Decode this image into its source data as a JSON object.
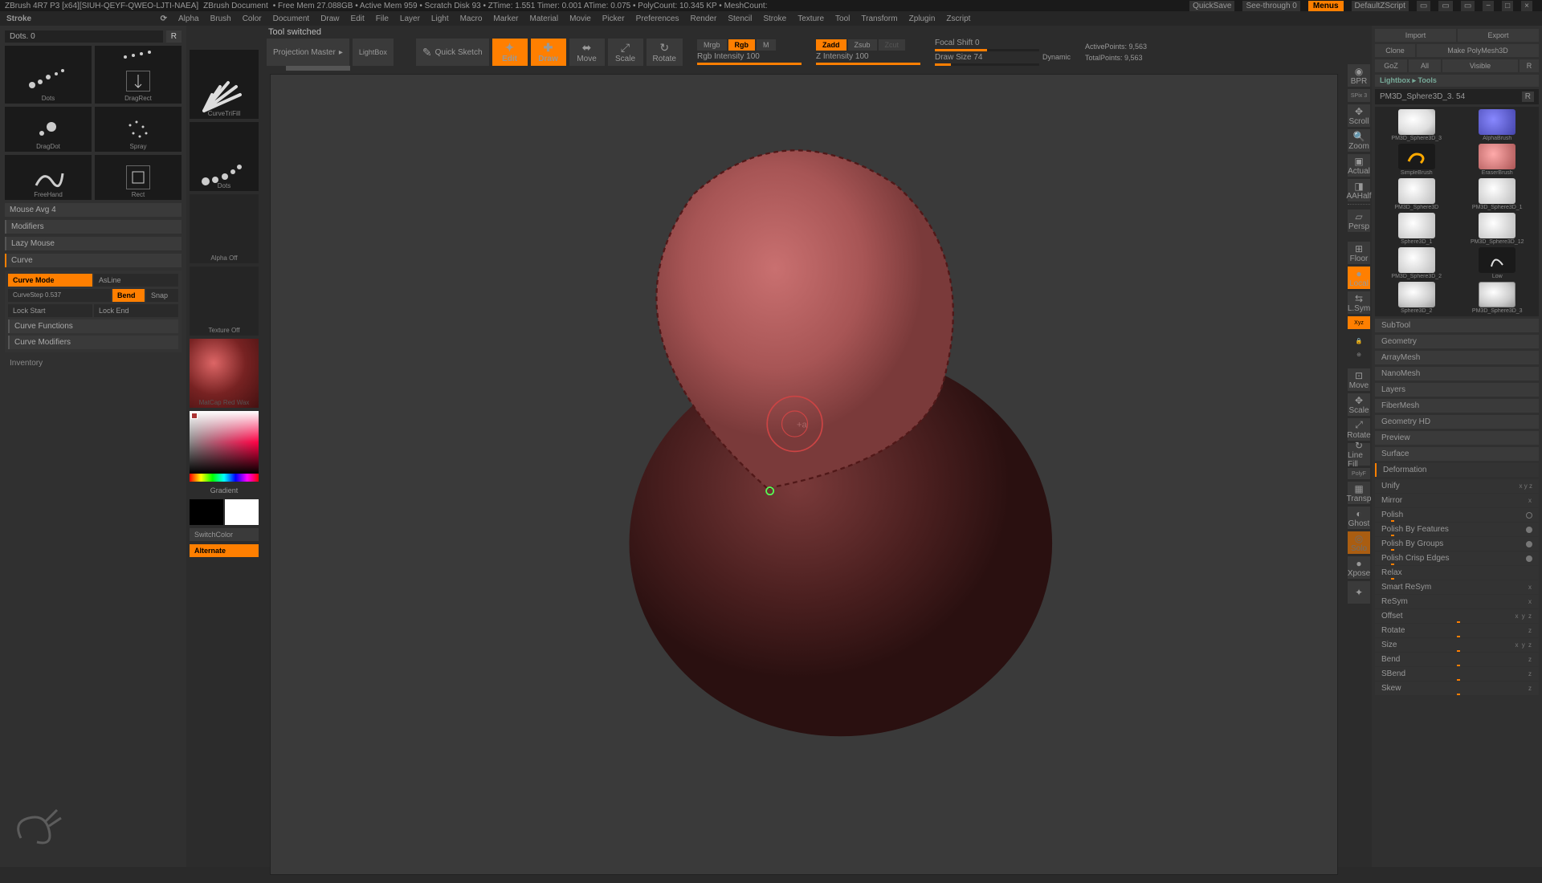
{
  "titlebar": {
    "left": "ZBrush 4R7 P3 [x64][SIUH-QEYF-QWEO-LJTI-NAEA]",
    "doc": "ZBrush Document",
    "mem": "• Free Mem 27.088GB  • Active Mem 959  • Scratch Disk 93  • ZTime: 1.551  Timer: 0.001  ATime: 0.075  • PolyCount: 10.345 KP  • MeshCount: ",
    "quicksave": "QuickSave",
    "seethrough": "See-through 0",
    "menus": "Menus",
    "script": "DefaultZScript"
  },
  "menubar": {
    "title": "Stroke",
    "items": [
      "Alpha",
      "Brush",
      "Color",
      "Document",
      "Draw",
      "Edit",
      "File",
      "Layer",
      "Light",
      "Macro",
      "Marker",
      "Material",
      "Movie",
      "Picker",
      "Preferences",
      "Render",
      "Stencil",
      "Stroke",
      "Texture",
      "Tool",
      "Transform",
      "Zplugin",
      "Zscript"
    ]
  },
  "status_msg": "Tool switched",
  "left": {
    "dots_label": "Dots. 0",
    "dots_r": "R",
    "cells": {
      "dots": "Dots",
      "dragrect": "DragRect",
      "dragdot": "DragDot",
      "spray": "Spray",
      "freehand": "FreeHand",
      "rect": "Rect"
    },
    "mouse_avg": "Mouse Avg 4",
    "modifiers": "Modifiers",
    "lazy": "Lazy Mouse",
    "curve": "Curve",
    "curve_mode": "Curve Mode",
    "asline": "AsLine",
    "curvestep": "CurveStep 0.537",
    "bend": "Bend",
    "snap": "Snap",
    "lock_start": "Lock Start",
    "lock_end": "Lock End",
    "curve_functions": "Curve Functions",
    "curve_modifiers": "Curve Modifiers",
    "inventory": "Inventory"
  },
  "toolcol": {
    "curvetrifill": "CurveTriFill",
    "dots": "Dots",
    "alpha_off": "Alpha Off",
    "texture_off": "Texture Off",
    "material": "MatCap Red Wax",
    "gradient": "Gradient",
    "switch": "SwitchColor",
    "alternate": "Alternate"
  },
  "toolbar": {
    "projection": "Projection Master",
    "lightbox": "LightBox",
    "quicksketch": "Quick Sketch",
    "edit": "Edit",
    "draw": "Draw",
    "move": "Move",
    "scale": "Scale",
    "rotate": "Rotate",
    "mrgb": "Mrgb",
    "rgb": "Rgb",
    "m": "M",
    "rgb_intensity": "Rgb Intensity 100",
    "zadd": "Zadd",
    "zsub": "Zsub",
    "zcut": "Zcut",
    "z_intensity": "Z Intensity 100",
    "focal_shift": "Focal Shift 0",
    "draw_size": "Draw Size 74",
    "dynamic": "Dynamic",
    "active_points": "ActivePoints: 9,563",
    "total_points": "TotalPoints: 9,563"
  },
  "vp": [
    "BPR",
    "SPix 3",
    "Scroll",
    "Zoom",
    "Actual",
    "AAHalf",
    "Persp",
    "Floor",
    "Local",
    "L.Sym",
    "Xyz",
    "Frame",
    "Move",
    "Scale",
    "Rotate",
    "Line Fill",
    "PolyF",
    "Transp",
    "Ghost",
    "Solo",
    "Xpose"
  ],
  "right": {
    "import": "Import",
    "export": "Export",
    "clone": "Clone",
    "make_poly": "Make PolyMesh3D",
    "goz": "GoZ",
    "all": "All",
    "visible": "Visible",
    "r": "R",
    "lightbox_tools": "Lightbox ▸ Tools",
    "tool_name": "PM3D_Sphere3D_3. 54",
    "tools": [
      {
        "label": "PM3D_Sphere3D_3"
      },
      {
        "label": "AlphaBrush"
      },
      {
        "label": "SimpleBrush"
      },
      {
        "label": "EraserBrush"
      },
      {
        "label": "PM3D_Sphere3D"
      },
      {
        "label": "PM3D_Sphere3D_1"
      },
      {
        "label": "Sphere3D_1"
      },
      {
        "label": "PM3D_Sphere3D_12"
      },
      {
        "label": "PM3D_Sphere3D_2"
      },
      {
        "label": "Low"
      },
      {
        "label": "Sphere3D_2"
      },
      {
        "label": "PM3D_Sphere3D_3"
      }
    ],
    "sections": [
      "SubTool",
      "Geometry",
      "ArrayMesh",
      "NanoMesh",
      "Layers",
      "FiberMesh",
      "Geometry HD",
      "Preview",
      "Surface"
    ],
    "deformation": "Deformation",
    "deforms": [
      {
        "label": "Unify",
        "xyz": ""
      },
      {
        "label": "Mirror",
        "xyz": "x"
      },
      {
        "label": "Polish",
        "xyz": "○"
      },
      {
        "label": "Polish By Features",
        "xyz": "•"
      },
      {
        "label": "Polish By Groups",
        "xyz": "•"
      },
      {
        "label": "Polish Crisp Edges",
        "xyz": "•"
      },
      {
        "label": "Relax",
        "xyz": ""
      },
      {
        "label": "Smart ReSym",
        "xyz": "x"
      },
      {
        "label": "ReSym",
        "xyz": "x"
      },
      {
        "label": "Offset",
        "xyz": "xyz"
      },
      {
        "label": "Rotate",
        "xyz": "z"
      },
      {
        "label": "Size",
        "xyz": "xyz"
      },
      {
        "label": "Bend",
        "xyz": "z"
      },
      {
        "label": "SBend",
        "xyz": "z"
      },
      {
        "label": "Skew",
        "xyz": "z"
      }
    ]
  }
}
